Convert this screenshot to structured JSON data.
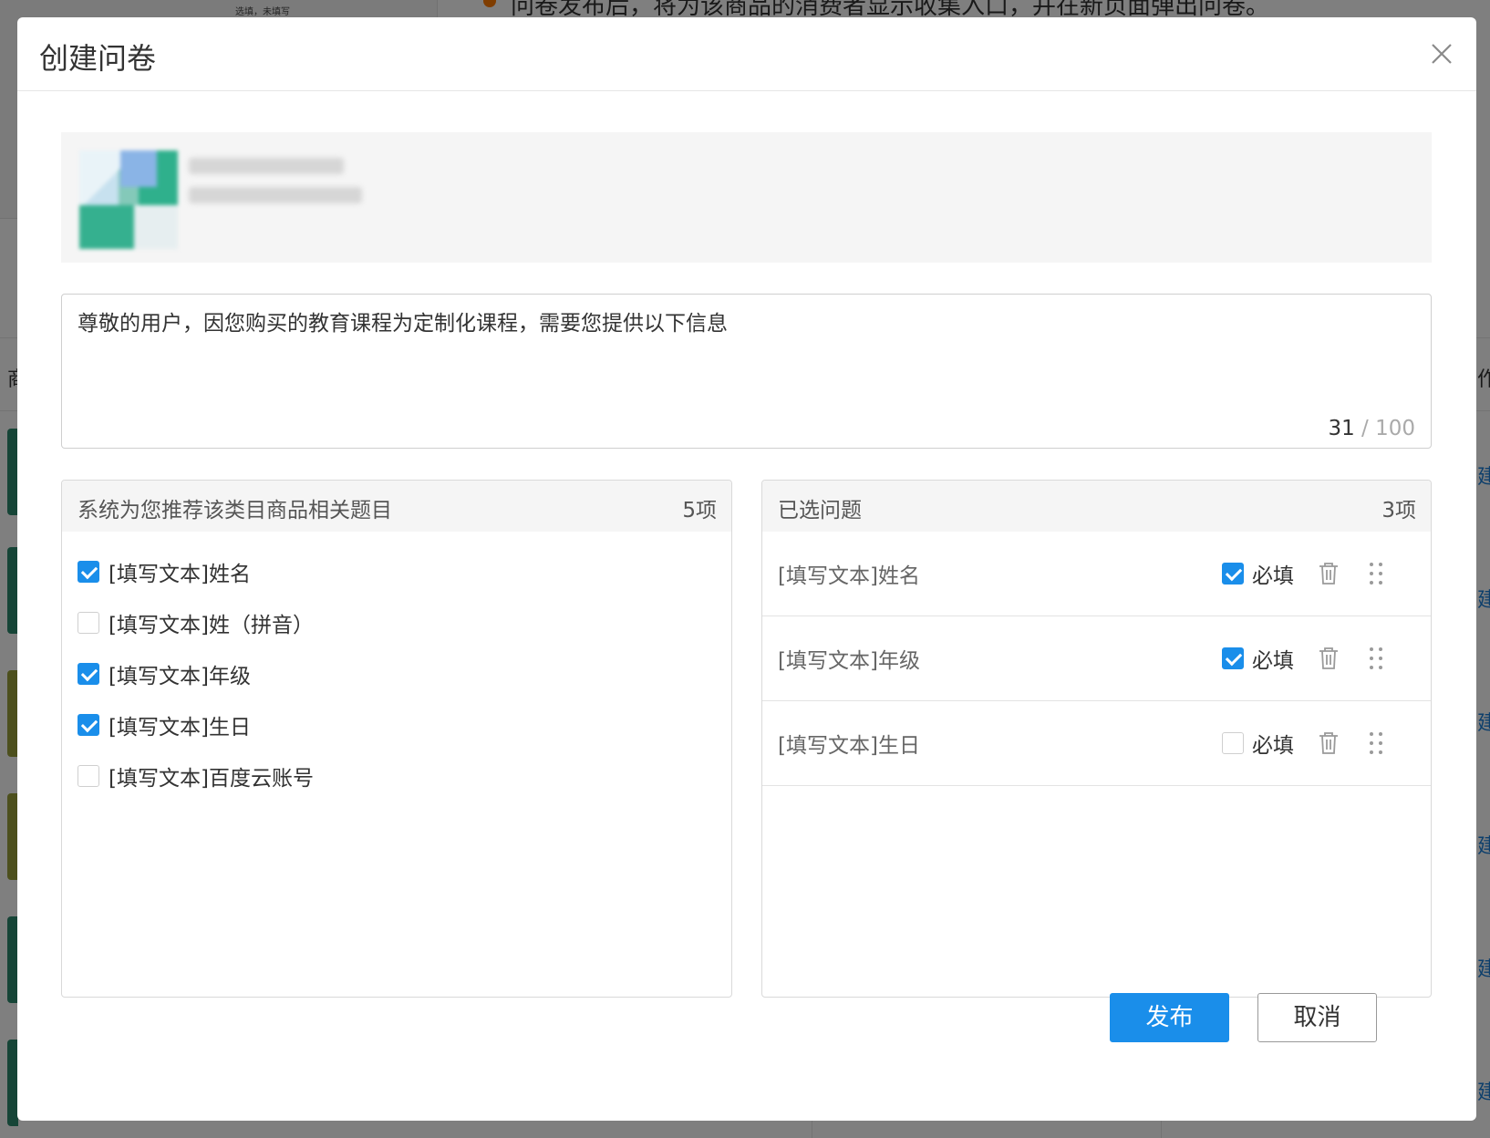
{
  "background": {
    "note": "选填，未填写",
    "headline": "问卷发布后，将为该商品的消费者显示收集入口，并在新页面弹出问卷。",
    "col_left": "商",
    "col_right": "作",
    "link_char": "建"
  },
  "dialog": {
    "title": "创建问卷",
    "close_icon": "close-icon"
  },
  "description": {
    "text": "尊敬的用户，因您购买的教育课程为定制化课程，需要您提供以下信息",
    "count": "31",
    "separator": "/",
    "max": "100"
  },
  "recommended": {
    "title": "系统为您推荐该类目商品相关题目",
    "count": "5项",
    "items": [
      {
        "label": "[填写文本]姓名",
        "checked": true
      },
      {
        "label": "[填写文本]姓（拼音）",
        "checked": false
      },
      {
        "label": "[填写文本]年级",
        "checked": true
      },
      {
        "label": "[填写文本]生日",
        "checked": true
      },
      {
        "label": "[填写文本]百度云账号",
        "checked": false
      }
    ]
  },
  "selected": {
    "title": "已选问题",
    "count": "3项",
    "required_label": "必填",
    "items": [
      {
        "label": "[填写文本]姓名",
        "required": true
      },
      {
        "label": "[填写文本]年级",
        "required": true
      },
      {
        "label": "[填写文本]生日",
        "required": false
      }
    ]
  },
  "footer": {
    "publish_label": "发布",
    "cancel_label": "取消"
  },
  "colors": {
    "primary": "#1a8eea",
    "panel_header": "#f5f5f5",
    "border": "#d9d9d9"
  }
}
